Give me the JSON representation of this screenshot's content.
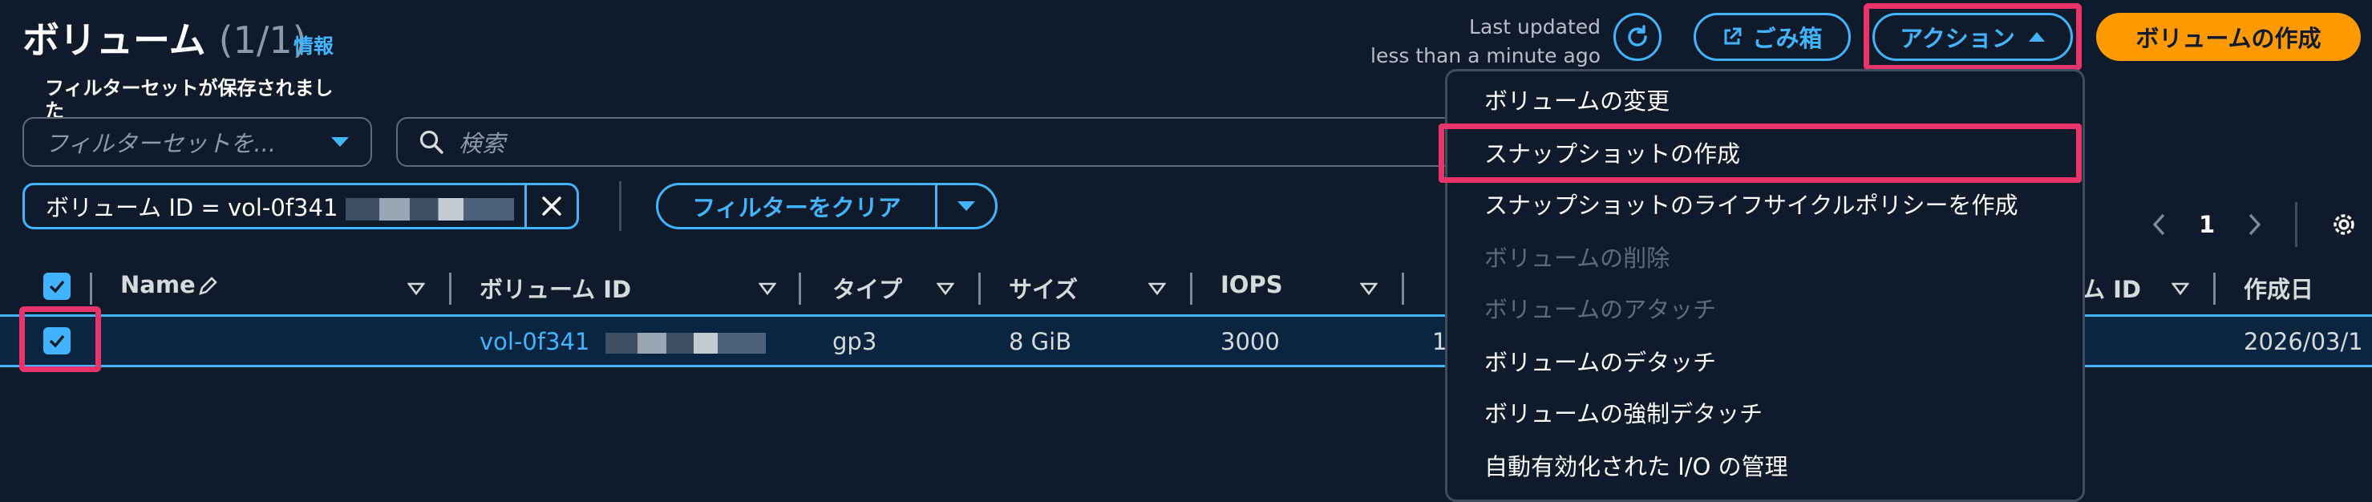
{
  "header": {
    "title": "ボリューム",
    "count": "(1/1)",
    "info_link": "情報",
    "last_updated_label": "Last updated",
    "last_updated_value": "less than a minute ago",
    "trash_label": "ごみ箱",
    "actions_label": "アクション",
    "create_label": "ボリュームの作成"
  },
  "filters": {
    "filterset_label": "フィルターセットが保存されました",
    "filterset_placeholder": "フィルターセットを...",
    "search_placeholder": "検索",
    "token_label": "ボリューム ID = vol-0f341",
    "clear_label": "フィルターをクリア"
  },
  "pagination": {
    "page": "1"
  },
  "table": {
    "headers": [
      "Name",
      "ボリューム ID",
      "タイプ",
      "サイズ",
      "IOPS",
      "ム ID",
      "作成日"
    ],
    "row": {
      "selected": true,
      "name": "",
      "volume_id": "vol-0f341",
      "type": "gp3",
      "size": "8 GiB",
      "iops": "3000",
      "throughput_fragment": "1",
      "created": "2026/03/1"
    }
  },
  "actions_menu": {
    "items": [
      {
        "label": "ボリュームの変更",
        "disabled": false
      },
      {
        "label": "スナップショットの作成",
        "disabled": false,
        "highlighted": true
      },
      {
        "label": "スナップショットのライフサイクルポリシーを作成",
        "disabled": false
      },
      {
        "label": "ボリュームの削除",
        "disabled": true
      },
      {
        "label": "ボリュームのアタッチ",
        "disabled": true
      },
      {
        "label": "ボリュームのデタッチ",
        "disabled": false
      },
      {
        "label": "ボリュームの強制デタッチ",
        "disabled": false
      },
      {
        "label": "自動有効化された I/O の管理",
        "disabled": false
      }
    ]
  },
  "colors": {
    "background": "#0f1b2a",
    "accent_blue": "#42b4ff",
    "primary_orange": "#ff9900",
    "annotation_pink": "#e8336b",
    "disabled_text": "#5f6b7a"
  },
  "icons": [
    "refresh-icon",
    "external-link-icon",
    "caret-up-icon",
    "caret-down-icon",
    "search-icon",
    "close-icon",
    "pencil-icon",
    "sort-icon",
    "chevron-left-icon",
    "chevron-right-icon",
    "gear-icon",
    "checkbox-checked-icon"
  ]
}
